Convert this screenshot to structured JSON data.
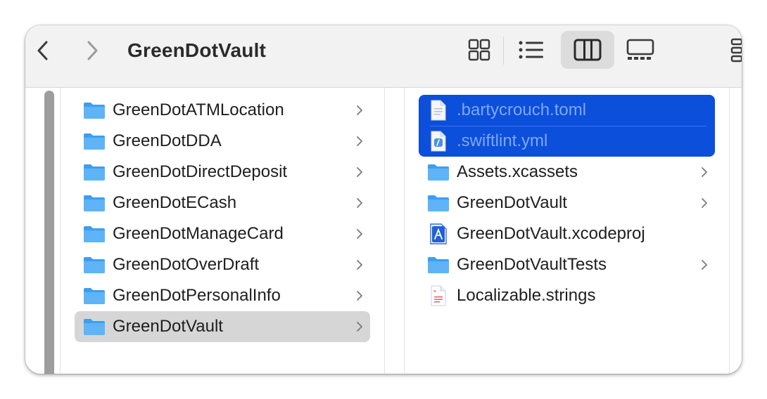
{
  "window": {
    "title": "GreenDotVault",
    "toolbar": {
      "back_icon": "chevron-left-icon",
      "forward_icon": "chevron-right-icon",
      "views": [
        {
          "name": "icon-view",
          "icon": "grid-icon",
          "active": false
        },
        {
          "name": "list-view",
          "icon": "list-icon",
          "active": false
        },
        {
          "name": "column-view",
          "icon": "columns-icon",
          "active": true
        },
        {
          "name": "gallery-view",
          "icon": "gallery-icon",
          "active": false
        }
      ]
    }
  },
  "column1": {
    "items": [
      {
        "label": "GreenDotATMLocation",
        "type": "folder",
        "has_children": true
      },
      {
        "label": "GreenDotDDA",
        "type": "folder",
        "has_children": true
      },
      {
        "label": "GreenDotDirectDeposit",
        "type": "folder",
        "has_children": true
      },
      {
        "label": "GreenDotECash",
        "type": "folder",
        "has_children": true
      },
      {
        "label": "GreenDotManageCard",
        "type": "folder",
        "has_children": true
      },
      {
        "label": "GreenDotOverDraft",
        "type": "folder",
        "has_children": true
      },
      {
        "label": "GreenDotPersonalInfo",
        "type": "folder",
        "has_children": true
      },
      {
        "label": "GreenDotVault",
        "type": "folder",
        "has_children": true,
        "selected": true
      }
    ]
  },
  "column2": {
    "items": [
      {
        "label": ".bartycrouch.toml",
        "type": "text-file",
        "selected": true
      },
      {
        "label": ".swiftlint.yml",
        "type": "yml-file",
        "selected": true
      },
      {
        "label": "Assets.xcassets",
        "type": "folder",
        "has_children": true
      },
      {
        "label": "GreenDotVault",
        "type": "folder",
        "has_children": true
      },
      {
        "label": "GreenDotVault.xcodeproj",
        "type": "xcodeproj",
        "has_children": false
      },
      {
        "label": "GreenDotVaultTests",
        "type": "folder",
        "has_children": true
      },
      {
        "label": "Localizable.strings",
        "type": "strings-file",
        "has_children": false
      }
    ]
  },
  "colors": {
    "selection_blue": "#0b4fdb",
    "folder_blue": "#3d9ef0",
    "selection_gray": "#d6d6d6"
  }
}
